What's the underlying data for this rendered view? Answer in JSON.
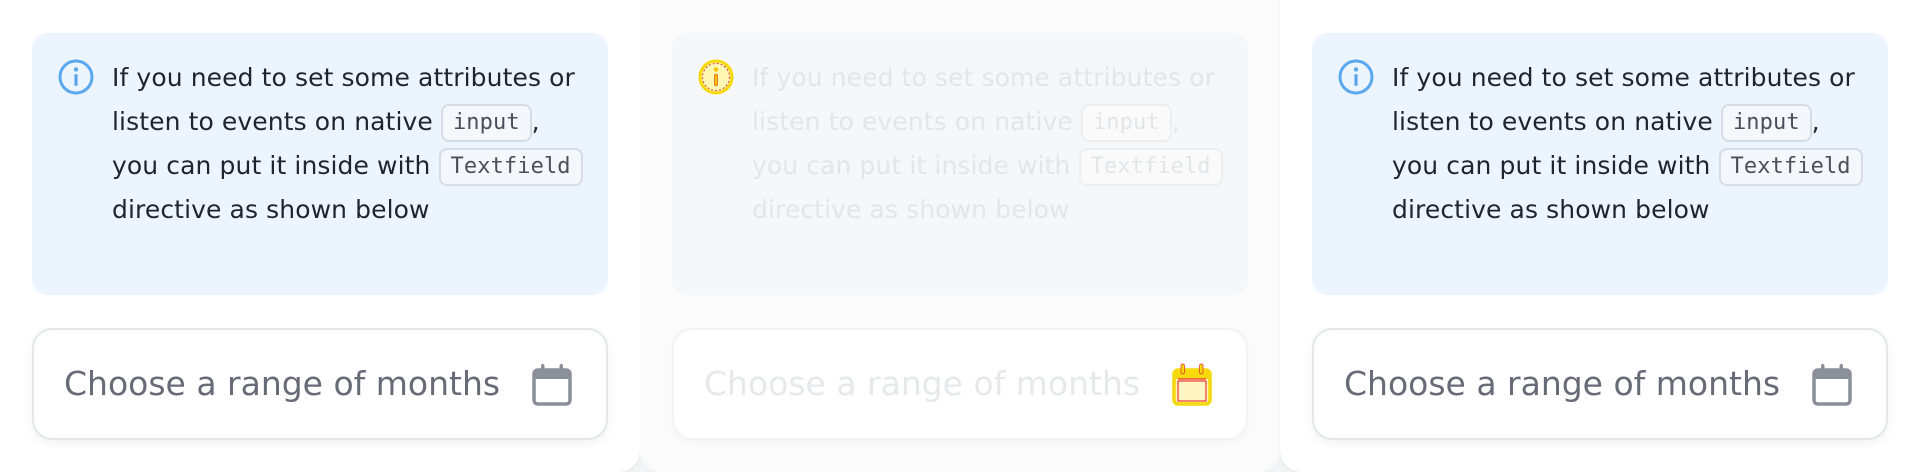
{
  "colors": {
    "alert_background": "#ecf4fd",
    "info_icon": "#5aa9ef",
    "calendar_icon": "#8a8f99",
    "disabled_icon_highlight": "#ffe600",
    "disabled_icon_outline": "#e53935"
  },
  "panels": [
    {
      "state": "enabled",
      "alert": {
        "icon": "info-icon",
        "text_before_input": "If you need to set some attributes or listen to events on native ",
        "input_code": "input",
        "text_after_input": ", you can put it inside with ",
        "textfield_code": "Textfield",
        "text_end": " directive as shown below"
      },
      "field": {
        "placeholder": "Choose a range of months",
        "icon": "calendar-icon"
      }
    },
    {
      "state": "disabled",
      "alert": {
        "icon": "info-icon",
        "text_before_input": "If you need to set some attributes or listen to events on native ",
        "input_code": "input",
        "text_after_input": ", you can put it inside with ",
        "textfield_code": "Textfield",
        "text_end": " directive as shown below"
      },
      "field": {
        "placeholder": "Choose a range of months",
        "icon": "calendar-icon"
      }
    },
    {
      "state": "enabled",
      "alert": {
        "icon": "info-icon",
        "text_before_input": "If you need to set some attributes or listen to events on native ",
        "input_code": "input",
        "text_after_input": ", you can put it inside with ",
        "textfield_code": "Textfield",
        "text_end": " directive as shown below"
      },
      "field": {
        "placeholder": "Choose a range of months",
        "icon": "calendar-icon"
      }
    }
  ]
}
